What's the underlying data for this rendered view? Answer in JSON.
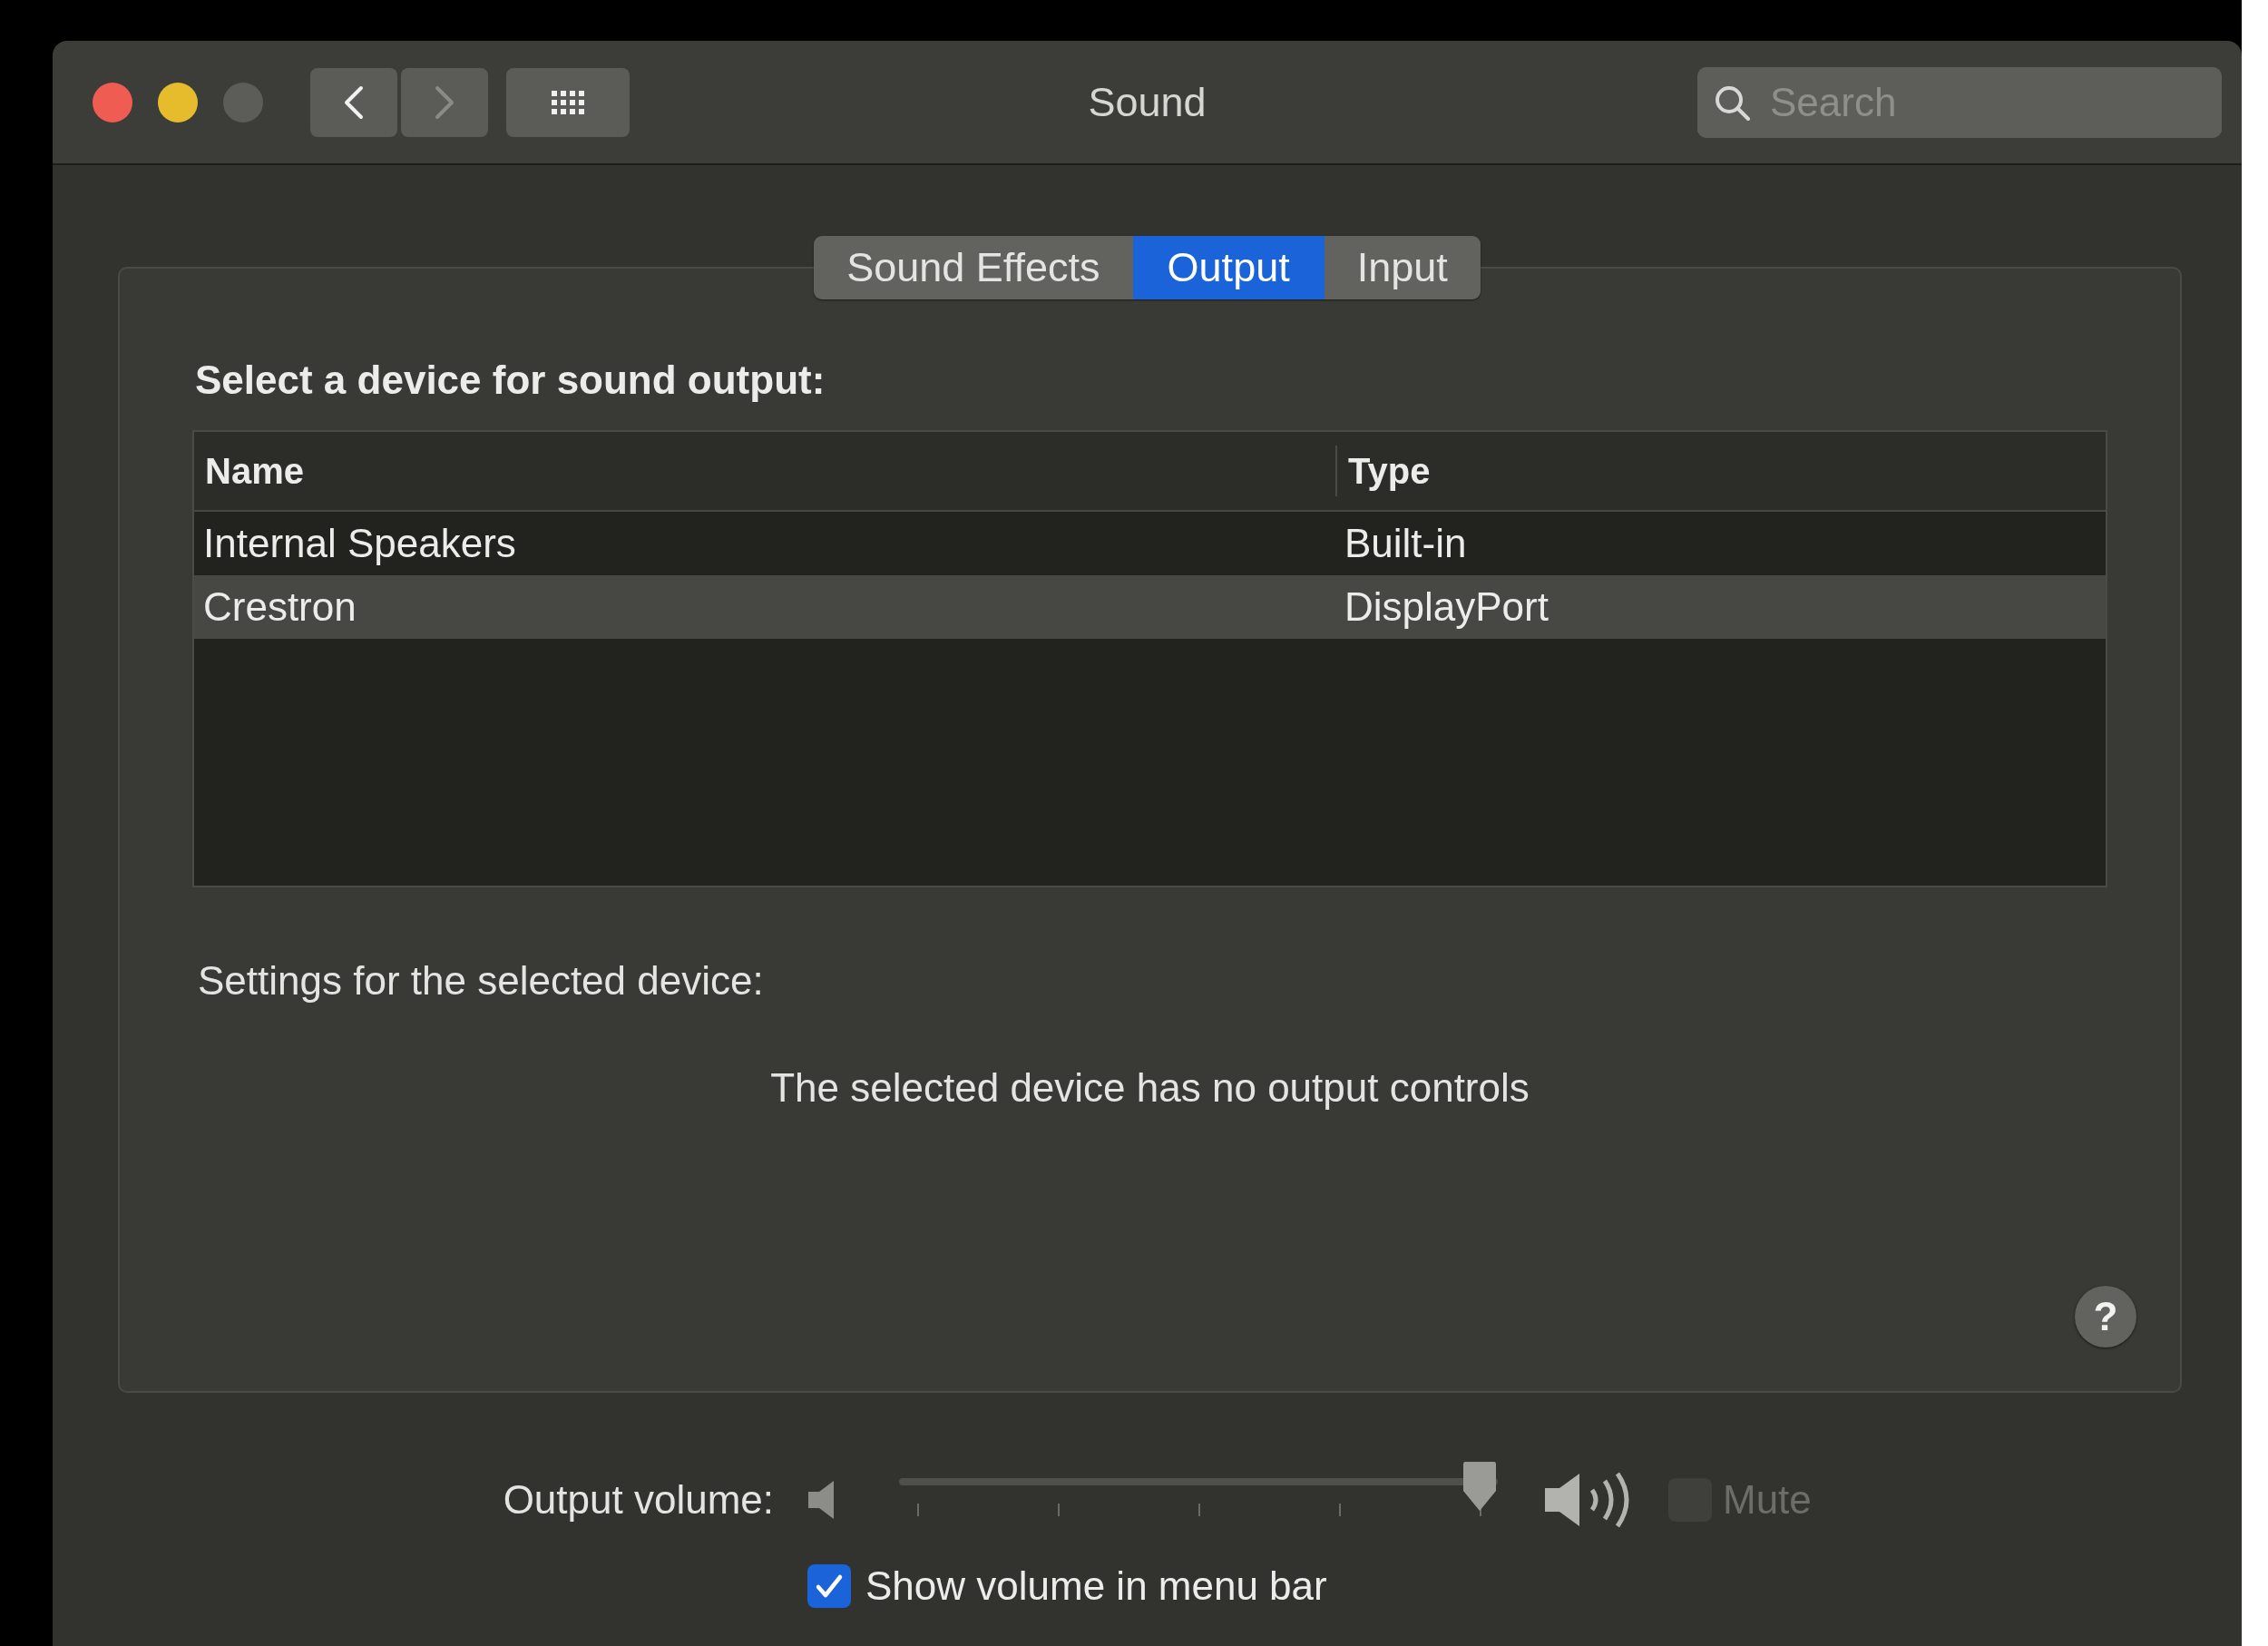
{
  "window": {
    "title": "Sound"
  },
  "navigation": [
    {
      "kind": "back",
      "disabled": false
    },
    {
      "kind": "forward",
      "disabled": true
    }
  ],
  "search": {
    "placeholder": "Search"
  },
  "tabs": [
    {
      "label": "Sound Effects",
      "selected": false
    },
    {
      "label": "Output",
      "selected": true
    },
    {
      "label": "Input",
      "selected": false
    }
  ],
  "output": {
    "heading": "Select a device for sound output:",
    "columns": [
      "Name",
      "Type"
    ],
    "rows": [
      {
        "name": "Internal Speakers",
        "type": "Built-in",
        "selected": false
      },
      {
        "name": "Crestron",
        "type": "DisplayPort",
        "selected": true
      }
    ],
    "settings_label": "Settings for the selected device:",
    "message": "The selected device has no output controls",
    "help": "?"
  },
  "volume": {
    "label": "Output volume:",
    "level": 0.97,
    "mute": {
      "label": "Mute",
      "checked": false,
      "disabled": true
    },
    "show_in_menu_bar": {
      "label": "Show volume in menu bar",
      "checked": true
    }
  }
}
